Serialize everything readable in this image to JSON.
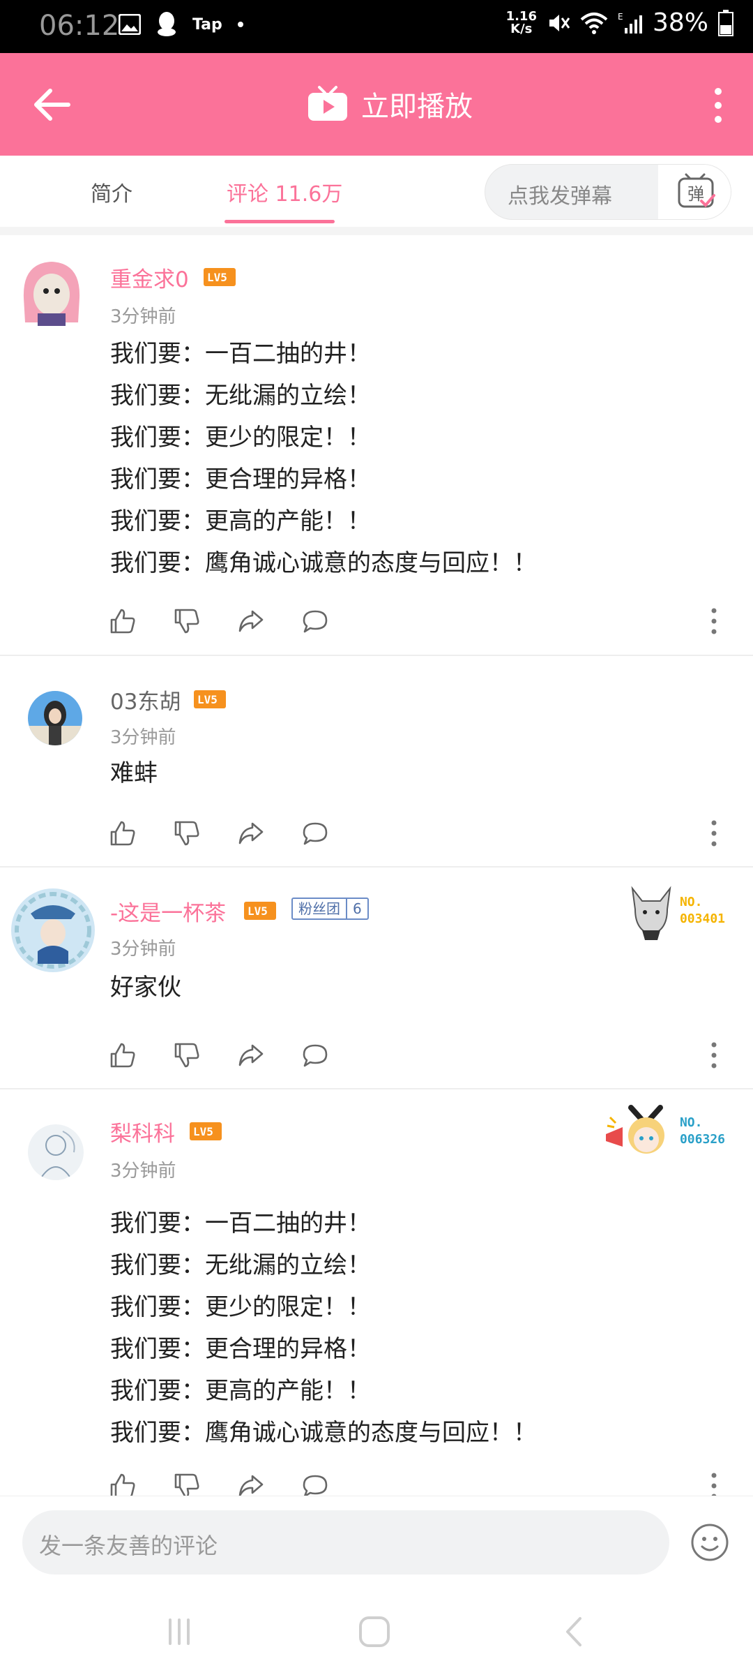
{
  "status": {
    "time": "06:12",
    "app_label": "Tap",
    "net_speed_top": "1.16",
    "net_speed_bottom": "K/s",
    "battery": "38%"
  },
  "header": {
    "title": "立即播放"
  },
  "tabs": {
    "intro": "简介",
    "comments": "评论 11.6万",
    "danmaku_placeholder": "点我发弹幕",
    "danmaku_icon_char": "弹"
  },
  "comments": [
    {
      "username": "重金求0",
      "level": "LV5",
      "time": "3分钟前",
      "lines": [
        "我们要：一百二抽的井！",
        "我们要：无纰漏的立绘！",
        "我们要：更少的限定！！",
        "我们要：更合理的异格！",
        "我们要：更高的产能！！",
        "我们要：鹰角诚心诚意的态度与回应！！"
      ]
    },
    {
      "username": "03东胡",
      "level": "LV5",
      "time": "3分钟前",
      "lines": [
        "难蚌"
      ]
    },
    {
      "username": "-这是一杯茶",
      "level": "LV5",
      "fan_label": "粉丝团",
      "fan_level": "6",
      "no_label": "NO.",
      "no_value": "003401",
      "time": "3分钟前",
      "lines": [
        "好家伙"
      ]
    },
    {
      "username": "梨科科",
      "level": "LV5",
      "no_label": "NO.",
      "no_value": "006326",
      "time": "3分钟前",
      "lines": [
        "我们要：一百二抽的井！",
        "我们要：无纰漏的立绘！",
        "我们要：更少的限定！！",
        "我们要：更合理的异格！",
        "我们要：更高的产能！！",
        "我们要：鹰角诚心诚意的态度与回应！！"
      ]
    }
  ],
  "bottom": {
    "placeholder": "发一条友善的评论"
  },
  "colors": {
    "accent": "#fb7299",
    "level_badge": "#f6911e",
    "fan_badge": "#6b8cc7",
    "no_text": "#f5b400"
  }
}
